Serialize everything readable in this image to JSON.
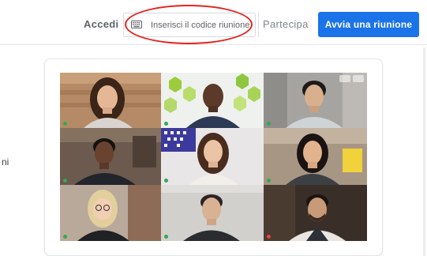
{
  "header": {
    "signin_label": "Accedi",
    "code_placeholder": "Inserisci il codice riunione",
    "join_label": "Partecipa",
    "start_label": "Avvia una riunione",
    "keyboard_icon": "keyboard-icon",
    "accent_color": "#1a73e8",
    "annotation_color": "#e32420"
  },
  "side_text": "ni",
  "preview": {
    "tiles": [
      {
        "name": ""
      },
      {
        "name": ""
      },
      {
        "name": ""
      },
      {
        "name": ""
      },
      {
        "name": ""
      },
      {
        "name": ""
      },
      {
        "name": ""
      },
      {
        "name": ""
      },
      {
        "name": ""
      }
    ]
  }
}
